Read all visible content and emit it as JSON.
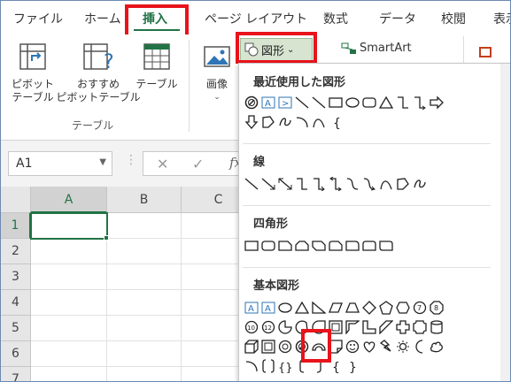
{
  "menu": {
    "tabs": [
      "ファイル",
      "ホーム",
      "挿入",
      "ページ レイアウト",
      "数式",
      "データ",
      "校閲",
      "表示"
    ],
    "active_tab": "挿入"
  },
  "ribbon": {
    "pivot_label_1": "ピボット",
    "pivot_label_2": "テーブル",
    "recommended_label_1": "おすすめ",
    "recommended_label_2": "ピボットテーブル",
    "table_label": "テーブル",
    "image_label": "画像",
    "shapes_label": "図形",
    "smartart_label": "SmartArt",
    "group_label": "テーブル"
  },
  "formula_bar": {
    "name_box": "A1",
    "fx": "fx"
  },
  "grid": {
    "columns": [
      "A",
      "B",
      "C"
    ],
    "rows": [
      "1",
      "2",
      "3",
      "4",
      "5",
      "6",
      "7"
    ],
    "active_cell": "A1"
  },
  "shapes_menu": {
    "sections": [
      {
        "title": "最近使用した図形"
      },
      {
        "title": "線"
      },
      {
        "title": "四角形"
      },
      {
        "title": "基本図形"
      }
    ]
  },
  "colors": {
    "excel_green": "#217346",
    "highlight_red": "#e8131b",
    "shape_outline": "#222222",
    "textbox_blue": "#2e75b6"
  }
}
